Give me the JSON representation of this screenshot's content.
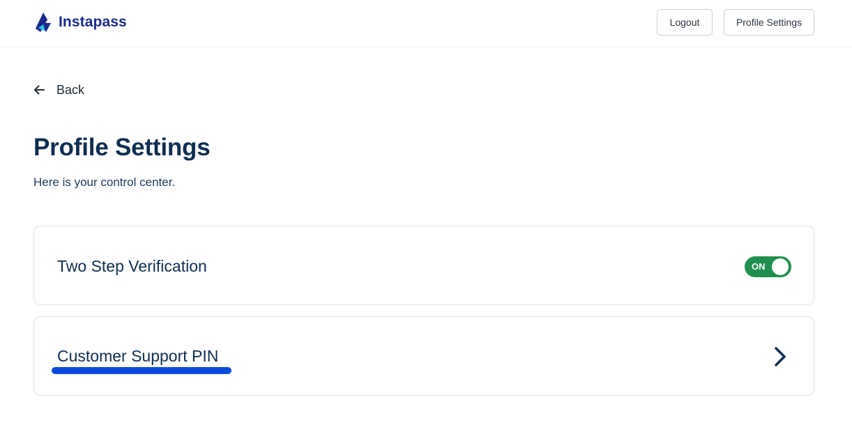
{
  "header": {
    "brand_name": "Instapass",
    "logout_label": "Logout",
    "profile_settings_label": "Profile Settings"
  },
  "nav": {
    "back_label": "Back"
  },
  "page": {
    "title": "Profile Settings",
    "subtitle": "Here is your control center."
  },
  "settings": [
    {
      "label": "Two Step Verification",
      "control": "toggle",
      "toggle_text": "ON",
      "toggle_on": true
    },
    {
      "label": "Customer Support PIN",
      "control": "chevron-right-icon"
    }
  ],
  "colors": {
    "brand": "#1b2a8c",
    "brand_accent": "#2ec4e6",
    "text_primary": "#0f2d4f",
    "toggle_on": "#1e8f4e",
    "annotation_underline": "#0a4bdb"
  },
  "icons": {
    "logo": "instapass-logo-icon",
    "back": "arrow-left-icon",
    "row_action": "chevron-right-icon"
  }
}
